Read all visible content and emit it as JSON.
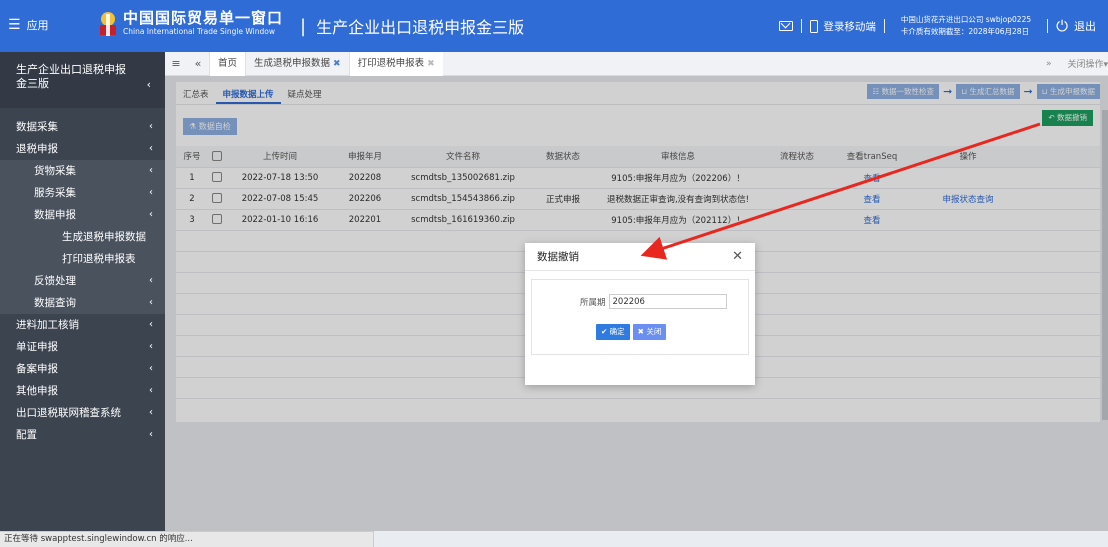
{
  "header": {
    "app_label": "应用",
    "brand_cn": "中国国际贸易单一窗口",
    "brand_en": "China International Trade Single Window",
    "system_name": "生产企业出口退税申报金三版",
    "mobile_login": "登录移动端",
    "company_line": "中国山货花卉进出口公司 swbjop0225",
    "cert_line": "卡介质有效期截至：2028年06月28日",
    "logout": "退出"
  },
  "sidebar": {
    "title_line1": "生产企业出口退税申报",
    "title_line2": "金三版",
    "items": [
      {
        "label": "数据采集",
        "level": 1
      },
      {
        "label": "退税申报",
        "level": 1
      },
      {
        "label": "货物采集",
        "level": 2
      },
      {
        "label": "服务采集",
        "level": 2
      },
      {
        "label": "数据申报",
        "level": 2
      },
      {
        "label": "生成退税申报数据",
        "level": 3
      },
      {
        "label": "打印退税申报表",
        "level": 3
      },
      {
        "label": "反馈处理",
        "level": 2
      },
      {
        "label": "数据查询",
        "level": 2
      },
      {
        "label": "进料加工核销",
        "level": 1
      },
      {
        "label": "单证申报",
        "level": 1
      },
      {
        "label": "备案申报",
        "level": 1
      },
      {
        "label": "其他申报",
        "level": 1
      },
      {
        "label": "出口退税联网稽查系统",
        "level": 1
      },
      {
        "label": "配置",
        "level": 1
      }
    ]
  },
  "tabs": {
    "home": "首页",
    "tab1": "生成退税申报数据",
    "tab2": "打印退税申报表",
    "close_ops": "关闭操作"
  },
  "subtabs": [
    "汇总表",
    "申报数据上传",
    "疑点处理"
  ],
  "flow_buttons": {
    "consistency": "数据一致性检查",
    "gen_summary": "生成汇总数据",
    "gen_declare": "生成申报数据",
    "revoke": "数据撤销",
    "self_check": "数据自检"
  },
  "table": {
    "headers": [
      "序号",
      "",
      "上传时间",
      "申报年月",
      "文件名称",
      "数据状态",
      "审核信息",
      "流程状态",
      "查看tranSeq",
      "操作"
    ],
    "rows": [
      {
        "no": "1",
        "time": "2022-07-18 13:50",
        "ym": "202208",
        "file": "scmdtsb_135002681.zip",
        "status": "",
        "audit": "9105:申报年月应为（202206）！",
        "flow": "",
        "view": "查看",
        "op": ""
      },
      {
        "no": "2",
        "time": "2022-07-08 15:45",
        "ym": "202206",
        "file": "scmdtsb_154543866.zip",
        "status": "正式申报",
        "audit": "退税数据正审查询,没有查询到状态信!",
        "flow": "",
        "view": "查看",
        "op": "申报状态查询"
      },
      {
        "no": "3",
        "time": "2022-01-10 16:16",
        "ym": "202201",
        "file": "scmdtsb_161619360.zip",
        "status": "",
        "audit": "9105:申报年月应为（202112）！",
        "flow": "",
        "view": "查看",
        "op": ""
      }
    ]
  },
  "modal": {
    "title": "数据撤销",
    "field_label": "所属期",
    "field_value": "202206",
    "confirm": "确定",
    "close": "关闭"
  },
  "statusbar": "正在等待 swapptest.singlewindow.cn 的响应..."
}
